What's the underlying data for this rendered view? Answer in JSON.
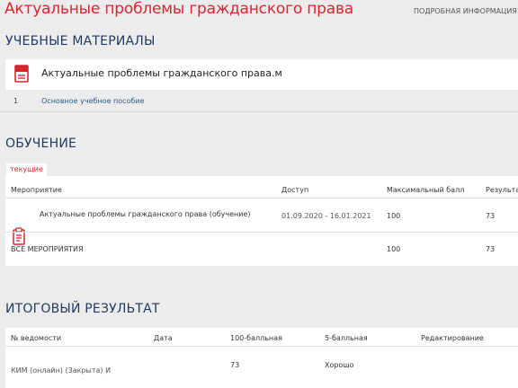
{
  "header": {
    "course_title": "Актуальные проблемы гражданского права",
    "details_link": "ПОДРОБНАЯ ИНФОРМАЦИЯ"
  },
  "materials": {
    "section_title": "УЧЕБНЫЕ МАТЕРИАЛЫ",
    "card_title": "Актуальные проблемы гражданского права.м",
    "rows": [
      {
        "num": "1",
        "label": "Основное учебное пособие"
      }
    ]
  },
  "training": {
    "section_title": "ОБУЧЕНИЕ",
    "tab_current": "текущие",
    "columns": {
      "event": "Мероприятие",
      "access": "Доступ",
      "max_score": "Максимальный балл",
      "result": "Результат"
    },
    "rows": [
      {
        "event": "Актуальные проблемы гражданского права (обучение)",
        "access": "01.09.2020 - 16.01.2021",
        "max_score": "100",
        "result": "73"
      }
    ],
    "total": {
      "label": "ВСЕ МЕРОПРИЯТИЯ",
      "max_score": "100",
      "result": "73"
    }
  },
  "final": {
    "section_title": "ИТОГОВЫЙ РЕЗУЛЬТАТ",
    "columns": {
      "sheet": "№ ведомости",
      "date": "Дата",
      "score100": "100-балльная",
      "score5": "5-балльная",
      "edit": "Редактирование"
    },
    "rows": [
      {
        "sheet": "КИМ (онлайн) (Закрыта) И",
        "date": "",
        "score100": "73",
        "score5": "Хорошо",
        "edit": ""
      }
    ]
  },
  "colors": {
    "accent_red": "#d9262f",
    "heading_blue": "#1f3a5f",
    "link_blue": "#2a5a8c"
  },
  "icons": {
    "material": "book-icon",
    "event": "clipboard-icon"
  }
}
